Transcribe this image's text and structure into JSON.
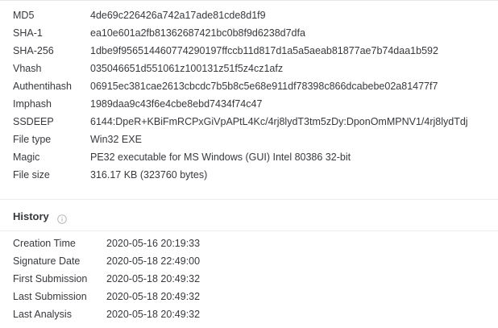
{
  "basic_properties": [
    {
      "key": "MD5",
      "value": "4de69c226426a742a17ade81cde8d1f9"
    },
    {
      "key": "SHA-1",
      "value": "ea10e601a2fb81362687421bc0b8f9d6238d7dfa"
    },
    {
      "key": "SHA-256",
      "value": "1dbe9f956514460774290197ffccb11d817d1a5a5aeab81877ae7b74daa1b592"
    },
    {
      "key": "Vhash",
      "value": "035046651d551061z100131z51f5z4cz1afz"
    },
    {
      "key": "Authentihash",
      "value": "06915ec381cae2613cbcdc7b5b8c5e68e911df78398c866dcabebe02a81477f7"
    },
    {
      "key": "Imphash",
      "value": "1989daa9c43f6e4cbe8ebd7434f74c47"
    },
    {
      "key": "SSDEEP",
      "value": "6144:DpeR+KBiFmRCPxGiVpAPtL4Kc/4rj8lydT3tm5zDy:DponOmMPNV1/4rj8lydTdj"
    },
    {
      "key": "File type",
      "value": "Win32 EXE"
    },
    {
      "key": "Magic",
      "value": "PE32 executable for MS Windows (GUI) Intel 80386 32-bit"
    },
    {
      "key": "File size",
      "value": "316.17 KB (323760 bytes)"
    }
  ],
  "history": {
    "title": "History",
    "info_icon": "info-circle-icon",
    "rows": [
      {
        "key": "Creation Time",
        "value": "2020-05-16 20:19:33"
      },
      {
        "key": "Signature Date",
        "value": "2020-05-18 22:49:00"
      },
      {
        "key": "First Submission",
        "value": "2020-05-18 20:49:32"
      },
      {
        "key": "Last Submission",
        "value": "2020-05-18 20:49:32"
      },
      {
        "key": "Last Analysis",
        "value": "2020-05-18 20:49:32"
      }
    ]
  },
  "colors": {
    "text": "#37393d",
    "icon": "#b8b8b8",
    "divider": "#ececec"
  }
}
